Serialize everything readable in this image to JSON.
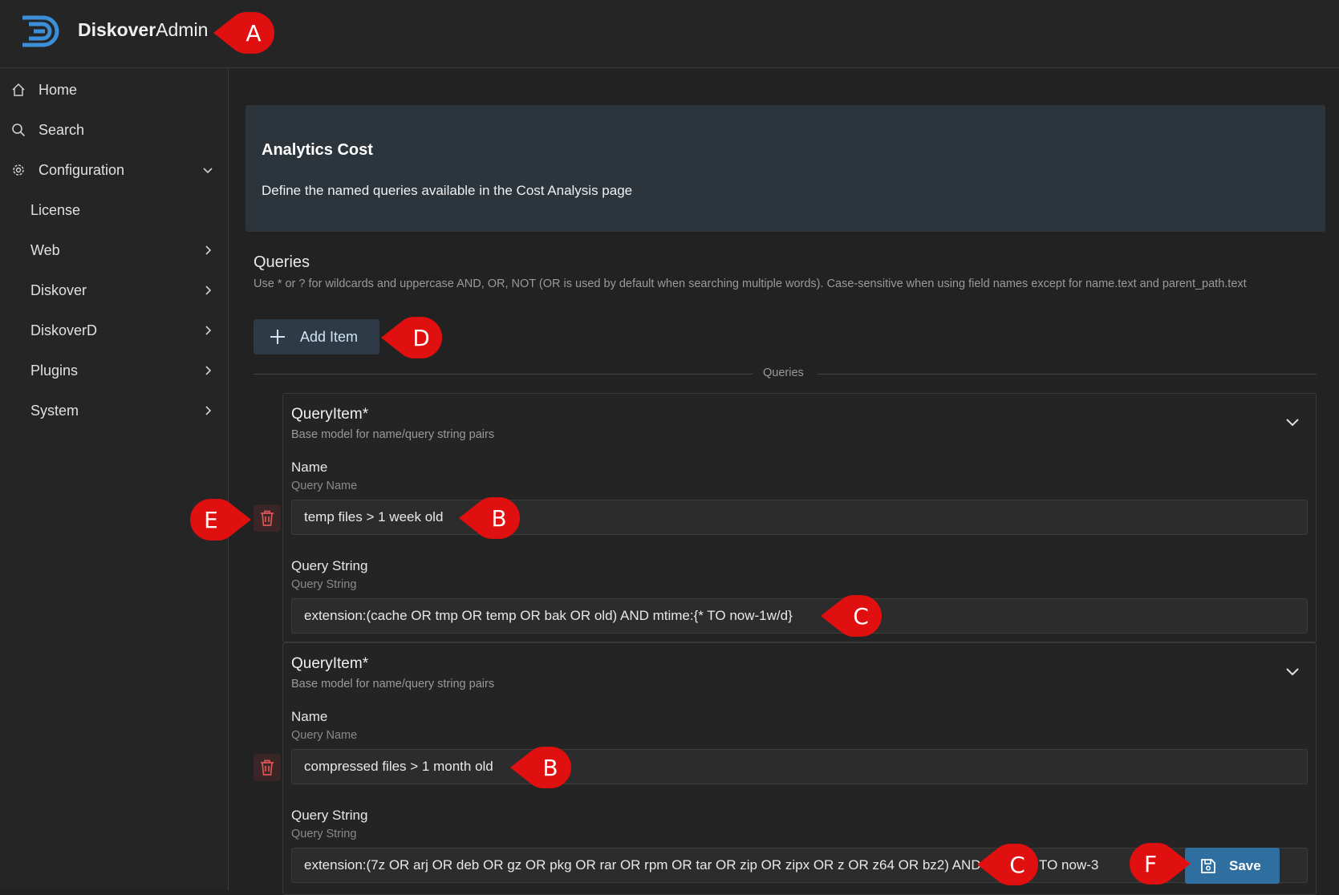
{
  "header": {
    "brand_bold": "Diskover",
    "brand_light": "Admin",
    "logo_icon": "diskover-logo-icon"
  },
  "sidebar": {
    "items": [
      {
        "label": "Home",
        "icon": "home-icon"
      },
      {
        "label": "Search",
        "icon": "search-icon"
      },
      {
        "label": "Configuration",
        "icon": "gear-icon",
        "expanded": true
      },
      {
        "label": "License"
      },
      {
        "label": "Web"
      },
      {
        "label": "Diskover"
      },
      {
        "label": "DiskoverD"
      },
      {
        "label": "Plugins"
      },
      {
        "label": "System"
      }
    ]
  },
  "banner": {
    "title": "Analytics Cost",
    "description": "Define the named queries available in the Cost Analysis page"
  },
  "queries": {
    "title": "Queries",
    "help": "Use * or ? for wildcards and uppercase AND, OR, NOT (OR is used by default when searching multiple words). Case-sensitive when using field names except for name.text and parent_path.text",
    "add_label": "Add Item",
    "divider_label": "Queries",
    "items": [
      {
        "title": "QueryItem*",
        "subtitle": "Base model for name/query string pairs",
        "name_label": "Name",
        "name_hint": "Query Name",
        "name_value": "temp files > 1 week old",
        "query_label": "Query String",
        "query_hint": "Query String",
        "query_value": "extension:(cache OR tmp OR temp OR bak OR old) AND mtime:{* TO now-1w/d}"
      },
      {
        "title": "QueryItem*",
        "subtitle": "Base model for name/query string pairs",
        "name_label": "Name",
        "name_hint": "Query Name",
        "name_value": "compressed files > 1 month old",
        "query_label": "Query String",
        "query_hint": "Query String",
        "query_value": "extension:(7z OR arj OR deb OR gz OR pkg OR rar OR rpm OR tar OR zip OR zipx OR z OR z64 OR bz2) AND mtime:{* TO now-3"
      }
    ]
  },
  "save_label": "Save",
  "markers": {
    "a": "A",
    "b1": "B",
    "b2": "B",
    "c1": "C",
    "c2": "C",
    "d": "D",
    "e": "E",
    "f": "F",
    "color": "#e01010"
  },
  "colors": {
    "background": "#222222",
    "banner": "#2c353c",
    "save_button": "#2f6fa0",
    "add_button": "#2e3b46",
    "logo_blue": "#3a8fd8"
  }
}
